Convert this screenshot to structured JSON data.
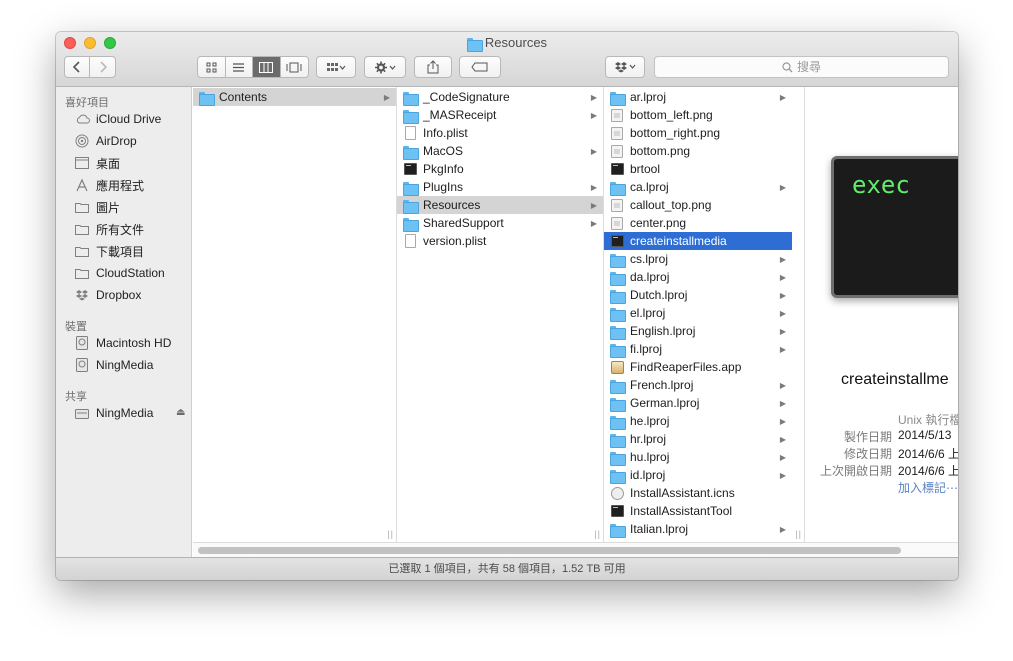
{
  "window": {
    "title": "Resources"
  },
  "toolbar": {
    "back_icon": "chevron-left-icon",
    "forward_icon": "chevron-right-icon",
    "view_modes": [
      "icon-view",
      "list-view",
      "column-view",
      "coverflow-view"
    ],
    "active_view": "column-view",
    "search_placeholder": "搜尋"
  },
  "sidebar": {
    "sections": [
      {
        "title": "喜好項目",
        "items": [
          {
            "label": "iCloud Drive",
            "icon": "cloud-icon"
          },
          {
            "label": "AirDrop",
            "icon": "airdrop-icon"
          },
          {
            "label": "桌面",
            "icon": "desktop-icon"
          },
          {
            "label": "應用程式",
            "icon": "applications-icon"
          },
          {
            "label": "圖片",
            "icon": "pictures-folder-icon"
          },
          {
            "label": "所有文件",
            "icon": "documents-folder-icon"
          },
          {
            "label": "下載項目",
            "icon": "downloads-folder-icon"
          },
          {
            "label": "CloudStation",
            "icon": "folder-icon"
          },
          {
            "label": "Dropbox",
            "icon": "dropbox-icon"
          }
        ]
      },
      {
        "title": "裝置",
        "items": [
          {
            "label": "Macintosh HD",
            "icon": "hard-drive-icon"
          },
          {
            "label": "NingMedia",
            "icon": "hard-drive-icon"
          }
        ]
      },
      {
        "title": "共享",
        "items": [
          {
            "label": "NingMedia",
            "icon": "network-server-icon"
          }
        ]
      }
    ]
  },
  "columns": [
    {
      "items": [
        {
          "name": "Contents",
          "type": "folder",
          "arrow": true,
          "selected": "gray"
        }
      ]
    },
    {
      "items": [
        {
          "name": "_CodeSignature",
          "type": "folder",
          "arrow": true
        },
        {
          "name": "_MASReceipt",
          "type": "folder",
          "arrow": true
        },
        {
          "name": "Info.plist",
          "type": "document",
          "arrow": false
        },
        {
          "name": "MacOS",
          "type": "folder",
          "arrow": true
        },
        {
          "name": "PkgInfo",
          "type": "executable",
          "arrow": false
        },
        {
          "name": "PlugIns",
          "type": "folder",
          "arrow": true
        },
        {
          "name": "Resources",
          "type": "folder",
          "arrow": true,
          "selected": "gray"
        },
        {
          "name": "SharedSupport",
          "type": "folder",
          "arrow": true
        },
        {
          "name": "version.plist",
          "type": "document",
          "arrow": false
        }
      ]
    },
    {
      "items": [
        {
          "name": "ar.lproj",
          "type": "folder",
          "arrow": true
        },
        {
          "name": "bottom_left.png",
          "type": "image",
          "arrow": false
        },
        {
          "name": "bottom_right.png",
          "type": "image",
          "arrow": false
        },
        {
          "name": "bottom.png",
          "type": "image",
          "arrow": false
        },
        {
          "name": "brtool",
          "type": "executable",
          "arrow": false
        },
        {
          "name": "ca.lproj",
          "type": "folder",
          "arrow": true
        },
        {
          "name": "callout_top.png",
          "type": "image",
          "arrow": false
        },
        {
          "name": "center.png",
          "type": "image",
          "arrow": false
        },
        {
          "name": "createinstallmedia",
          "type": "executable",
          "arrow": false,
          "selected": "blue"
        },
        {
          "name": "cs.lproj",
          "type": "folder",
          "arrow": true
        },
        {
          "name": "da.lproj",
          "type": "folder",
          "arrow": true
        },
        {
          "name": "Dutch.lproj",
          "type": "folder",
          "arrow": true
        },
        {
          "name": "el.lproj",
          "type": "folder",
          "arrow": true
        },
        {
          "name": "English.lproj",
          "type": "folder",
          "arrow": true
        },
        {
          "name": "fi.lproj",
          "type": "folder",
          "arrow": true
        },
        {
          "name": "FindReaperFiles.app",
          "type": "app",
          "arrow": false
        },
        {
          "name": "French.lproj",
          "type": "folder",
          "arrow": true
        },
        {
          "name": "German.lproj",
          "type": "folder",
          "arrow": true
        },
        {
          "name": "he.lproj",
          "type": "folder",
          "arrow": true
        },
        {
          "name": "hr.lproj",
          "type": "folder",
          "arrow": true
        },
        {
          "name": "hu.lproj",
          "type": "folder",
          "arrow": true
        },
        {
          "name": "id.lproj",
          "type": "folder",
          "arrow": true
        },
        {
          "name": "InstallAssistant.icns",
          "type": "icns",
          "arrow": false
        },
        {
          "name": "InstallAssistantTool",
          "type": "executable",
          "arrow": false
        },
        {
          "name": "Italian.lproj",
          "type": "folder",
          "arrow": true
        }
      ]
    }
  ],
  "preview": {
    "icon_text": "exec",
    "name": "createinstallme",
    "kind": "Unix 執行檔",
    "rows": [
      {
        "label": "製作日期",
        "value": "2014/5/13"
      },
      {
        "label": "修改日期",
        "value": "2014/6/6 上"
      },
      {
        "label": "上次開啟日期",
        "value": "2014/6/6 上"
      }
    ],
    "add_tags": "加入標記⋯"
  },
  "status_bar": {
    "text": "已選取 1 個項目，共有 58 個項目，1.52 TB 可用"
  }
}
